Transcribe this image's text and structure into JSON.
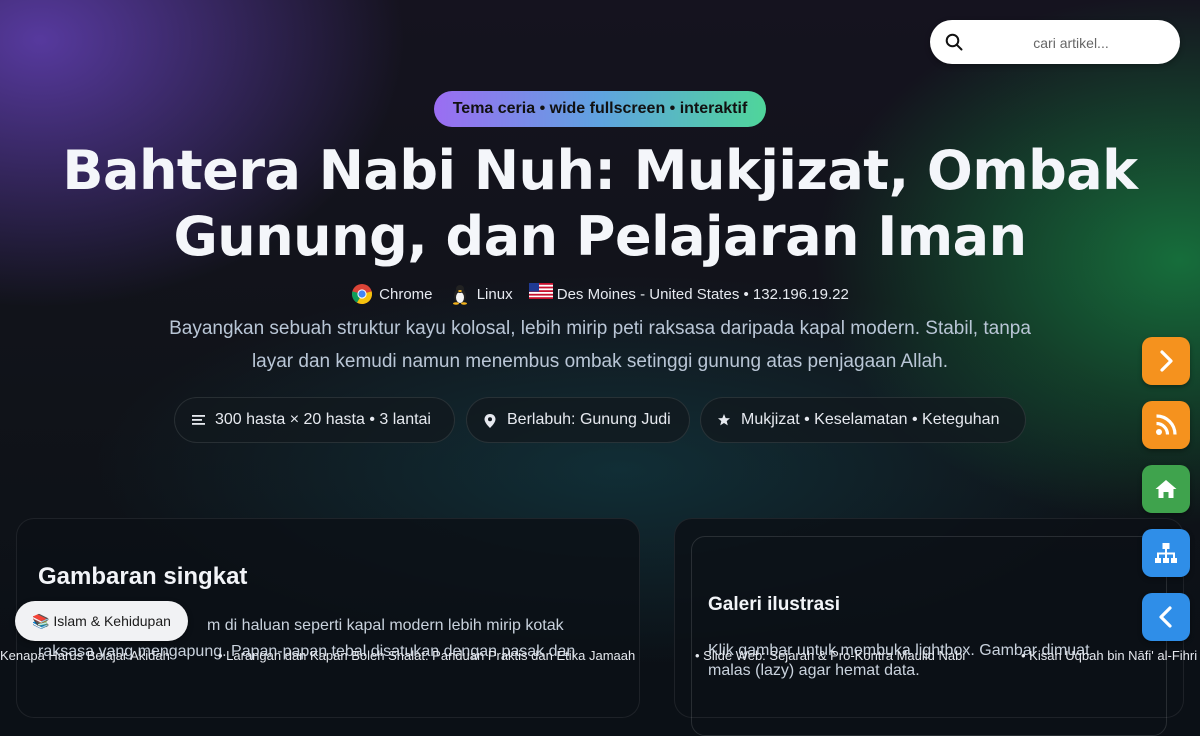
{
  "search": {
    "placeholder": "cari artikel..."
  },
  "hero": {
    "tag": "Tema ceria • wide fullscreen • interaktif",
    "title": "Bahtera Nabi Nuh: Mukjizat, Ombak Gunung, dan Pelajaran Iman",
    "meta": {
      "browser": "Chrome",
      "os": "Linux",
      "location": "Des Moines - United States • 132.196.19.22"
    },
    "lead": "Bayangkan sebuah struktur kayu kolosal, lebih mirip peti raksasa daripada kapal modern. Stabil, tanpa layar dan kemudi namun menembus ombak setinggi gunung atas penjagaan Allah.",
    "chips": [
      {
        "icon": "list-icon",
        "text": "300 hasta × 20 hasta • 3 lantai"
      },
      {
        "icon": "map-pin-icon",
        "text": "Berlabuh: Gunung Judi"
      },
      {
        "icon": "star-icon",
        "text": "Mukjizat • Keselamatan • Keteguhan"
      }
    ]
  },
  "summary": {
    "title": "Gambaran singkat",
    "line1": "m di haluan seperti kapal modern lebih mirip kotak",
    "line2": "raksasa yang mengapung. Papan-papan tebal disatukan dengan pasak dan"
  },
  "gallery": {
    "title": "Galeri ilustrasi",
    "text": "Klik gambar untuk membuka lightbox. Gambar dimuat malas (lazy) agar hemat data."
  },
  "category_pill": "📚 Islam & Kehidupan",
  "ticker": [
    "Kenapa Harus Belajar Akidah",
    "• Larangan dan Kapan Boleh Shalat: Panduan Praktis dan Etika Jamaah",
    "• Slide Web: Sejarah & Pro-Kontra Maulid Nabi",
    "• Kisah Uqbah bin Nāfi' al-Fihri"
  ],
  "fabs": [
    {
      "icon": "chevron-right-icon",
      "color": "#f5921e"
    },
    {
      "icon": "rss-icon",
      "color": "#f5921e"
    },
    {
      "icon": "home-icon",
      "color": "#3fa34d"
    },
    {
      "icon": "sitemap-icon",
      "color": "#2f8ee8"
    },
    {
      "icon": "chevron-left-icon",
      "color": "#2f8ee8"
    }
  ]
}
